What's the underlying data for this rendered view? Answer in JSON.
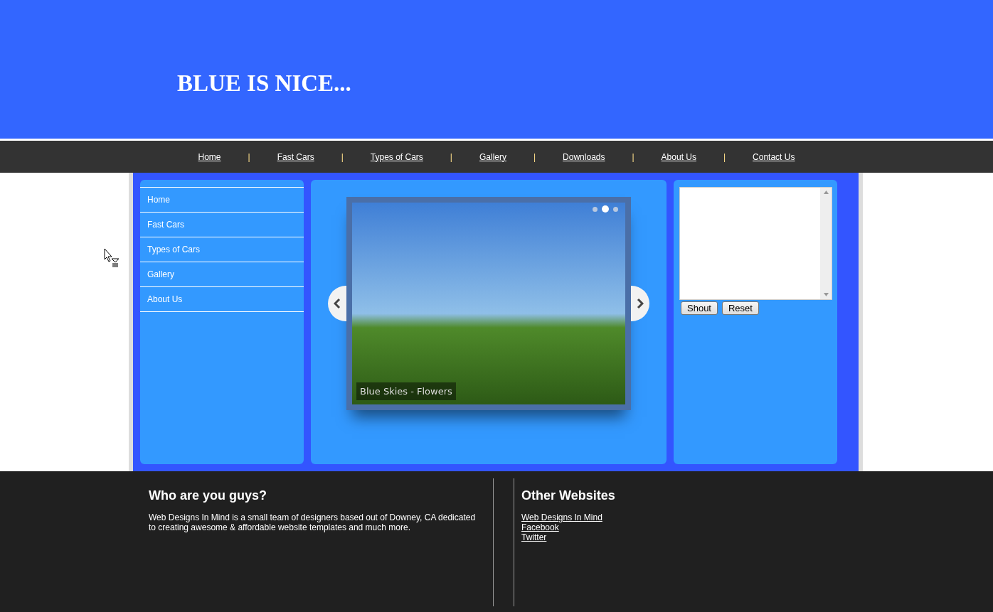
{
  "header": {
    "title": "BLUE IS NICE..."
  },
  "nav": {
    "items": [
      "Home",
      "Fast Cars",
      "Types of Cars",
      "Gallery",
      "Downloads",
      "About Us",
      "Contact Us"
    ],
    "separator": "|"
  },
  "sidebar": {
    "items": [
      "Home",
      "Fast Cars",
      "Types of Cars",
      "Gallery",
      "About Us"
    ]
  },
  "slider": {
    "caption": "Blue Skies - Flowers",
    "dots": [
      {
        "selected": false
      },
      {
        "selected": true
      },
      {
        "selected": false
      }
    ]
  },
  "shoutbox": {
    "buttons": [
      "Shout",
      "Reset"
    ]
  },
  "footer": {
    "about": {
      "heading": "Who are you guys?",
      "text": "Web Designs In Mind is a small team of designers based out of Downey, CA dedicated to creating awesome & affordable website templates and much more."
    },
    "links": {
      "heading": "Other Websites",
      "items": [
        "Web Designs In Mind",
        "Facebook",
        "Twitter"
      ]
    }
  }
}
